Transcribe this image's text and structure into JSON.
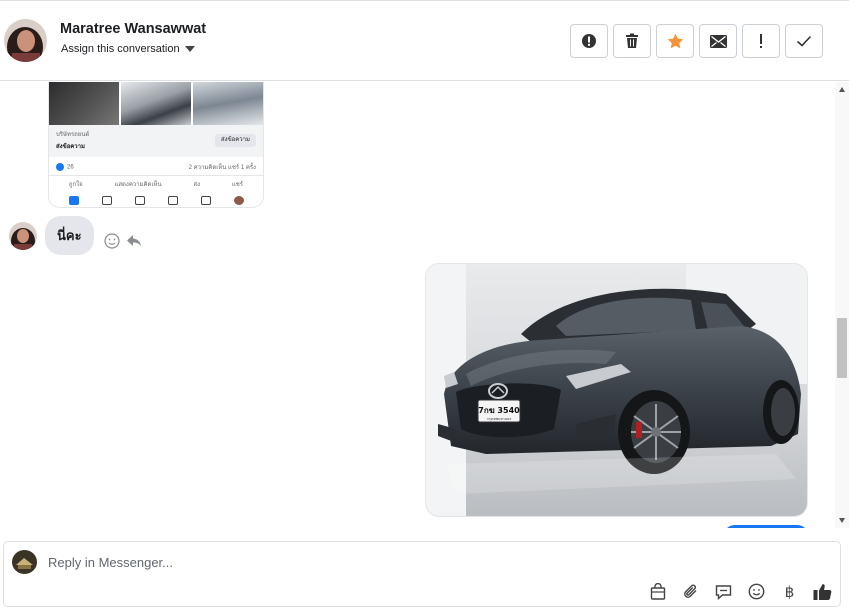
{
  "header": {
    "contact_name": "Maratree Wansawwat",
    "assign_label": "Assign this conversation",
    "actions": [
      {
        "name": "spam-button",
        "icon": "alert-circle-icon"
      },
      {
        "name": "delete-button",
        "icon": "trash-icon"
      },
      {
        "name": "star-button",
        "icon": "star-icon"
      },
      {
        "name": "mark-unread-button",
        "icon": "envelope-icon"
      },
      {
        "name": "follow-up-button",
        "icon": "exclamation-icon"
      },
      {
        "name": "done-button",
        "icon": "checkmark-icon"
      }
    ],
    "star_color": "#f7923b"
  },
  "shared_post": {
    "page_label": "บริษัทรถยนต์",
    "title": "ส่งข้อความ",
    "cta": "ส่งข้อความ",
    "likes": "26",
    "stats": "2 ความคิดเห็น  แชร์ 1 ครั้ง",
    "actions": [
      "ถูกใจ",
      "แสดงความคิดเห็น",
      "ส่ง",
      "แชร์"
    ]
  },
  "message": {
    "text": "นี่คะ"
  },
  "car": {
    "plate_line1": "7กฆ 3540",
    "plate_line2": "กรุงเทพมหานคร"
  },
  "composer": {
    "placeholder": "Reply in Messenger...",
    "tools": [
      "shopping-bag-icon",
      "paperclip-icon",
      "saved-reply-icon",
      "emoji-icon",
      "baht-icon",
      "thumbs-up-icon"
    ],
    "baht_symbol": "฿"
  },
  "colors": {
    "accent_blue": "#1877f2",
    "bubble_gray": "#e4e6eb"
  }
}
